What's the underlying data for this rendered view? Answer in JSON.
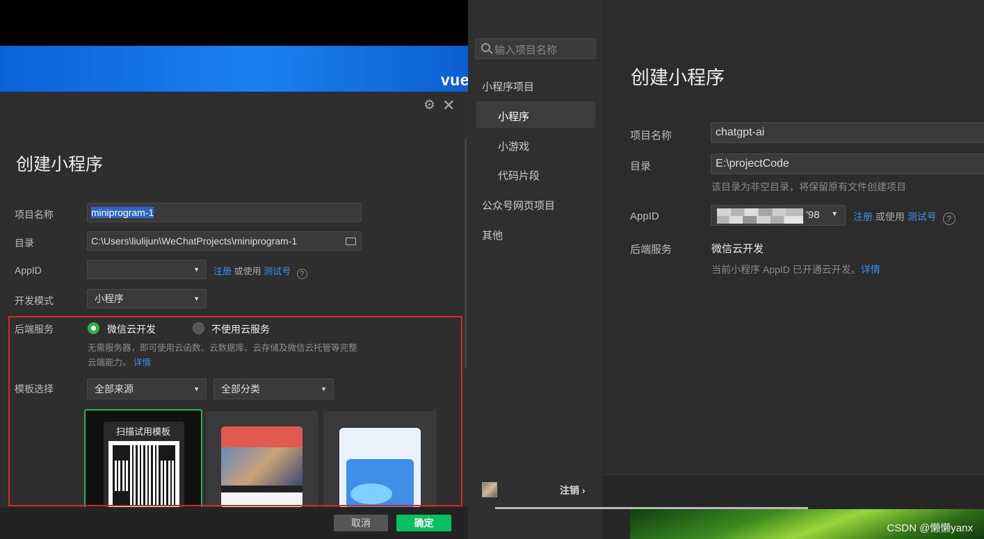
{
  "left_dialog": {
    "banner_text": "vue",
    "title": "创建小程序",
    "labels": {
      "project_name": "项目名称",
      "directory": "目录",
      "appid": "AppID",
      "dev_mode": "开发模式",
      "backend": "后端服务",
      "template": "模板选择"
    },
    "project_name_value": "miniprogram-1",
    "directory_value": "C:\\Users\\liulijun\\WeChatProjects\\miniprogram-1",
    "appid_links": {
      "register": "注册",
      "or_use": "或使用",
      "test_account": "测试号"
    },
    "dev_mode_value": "小程序",
    "backend_options": [
      "微信云开发",
      "不使用云服务"
    ],
    "backend_selected": "微信云开发",
    "backend_desc": "无需服务器，即可使用云函数、云数据库、云存储及微信云托管等完整云端能力。",
    "backend_desc_line1": "无需服务器，即可使用云函数、云数据库、云存储及微信云托管等完整",
    "backend_desc_line2": "云端能力。",
    "details_link": "详情",
    "template_source": "全部来源",
    "template_category": "全部分类",
    "template_card1_title": "扫描试用模板",
    "cancel_label": "取消",
    "confirm_label": "确定"
  },
  "sidebar": {
    "search_placeholder": "输入项目名称",
    "items": [
      {
        "label": "小程序项目"
      },
      {
        "label": "小程序"
      },
      {
        "label": "小游戏"
      },
      {
        "label": "代码片段"
      },
      {
        "label": "公众号网页项目"
      },
      {
        "label": "其他"
      }
    ],
    "logout_label": "注销"
  },
  "main": {
    "title": "创建小程序",
    "labels": {
      "project_name": "项目名称",
      "directory": "目录",
      "appid": "AppID",
      "backend": "后端服务"
    },
    "project_name_value": "chatgpt-ai",
    "directory_value": "E:\\projectCode",
    "directory_hint": "该目录为非空目录，将保留原有文件创建项目",
    "appid_suffix": "'98",
    "appid_links": {
      "register": "注册",
      "or_use": "或使用",
      "test_account": "测试号"
    },
    "backend_value": "微信云开发",
    "backend_hint": "当前小程序 AppID 已开通云开发。",
    "details_link": "详情",
    "watermark": "CSDN @懒懒yanx"
  },
  "colors": {
    "accent_green": "#2bb24c",
    "link_blue": "#3b8ff0",
    "highlight_red": "#e02424"
  }
}
